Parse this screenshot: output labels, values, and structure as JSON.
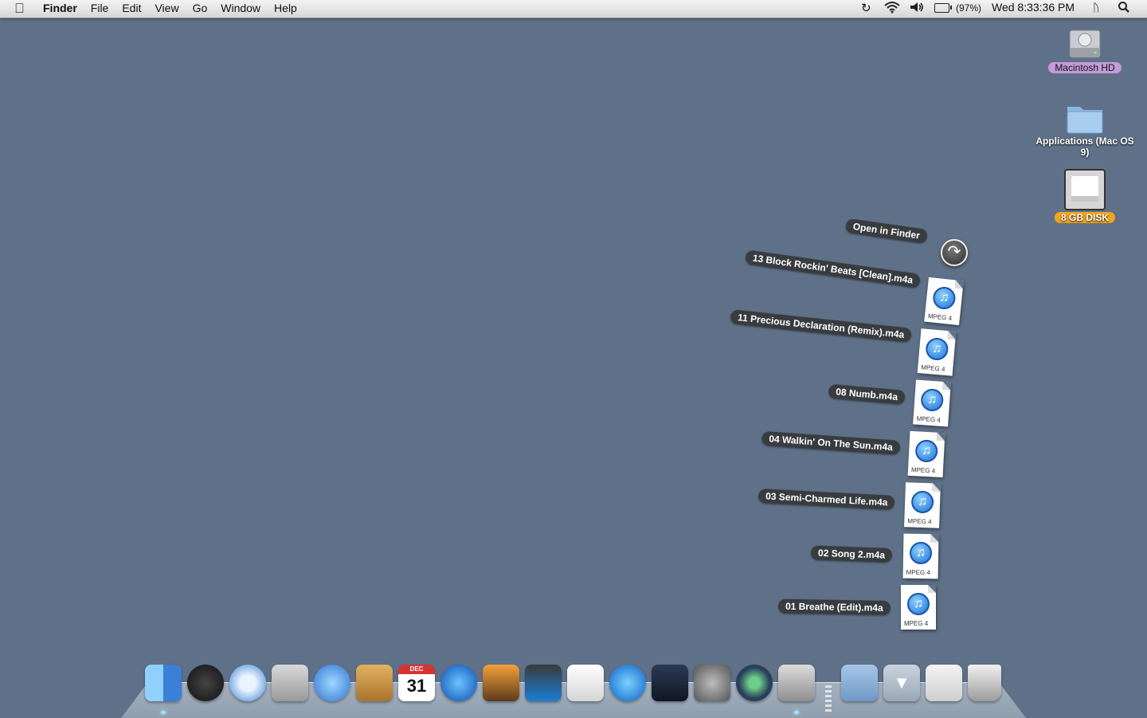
{
  "menubar": {
    "app_name": "Finder",
    "menus": [
      "File",
      "Edit",
      "View",
      "Go",
      "Window",
      "Help"
    ],
    "battery_percent": "(97%)",
    "clock": "Wed 8:33:36 PM",
    "status_icons": [
      "time-machine-icon",
      "wifi-icon",
      "volume-icon",
      "battery-icon",
      "bluetooth-icon",
      "spotlight-icon"
    ]
  },
  "desktop": {
    "icons": [
      {
        "label": "Macintosh HD",
        "icon": "hard-drive-icon",
        "label_color": "#c49ad8"
      },
      {
        "label": "Applications (Mac OS 9)",
        "icon": "folder-icon"
      },
      {
        "label": "8 GB DISK",
        "icon": "usb-disk-icon",
        "label_color": "#f3a51c"
      }
    ]
  },
  "stack": {
    "open_in_finder": "Open in Finder",
    "file_type": "MPEG 4",
    "files": [
      "13 Block Rockin' Beats [Clean].m4a",
      "11 Precious Declaration (Remix).m4a",
      "08 Numb.m4a",
      "04 Walkin' On The Sun.m4a",
      "03 Semi-Charmed Life.m4a",
      "02 Song 2.m4a",
      "01 Breathe (Edit).m4a"
    ]
  },
  "dock": {
    "apps": [
      "finder-icon",
      "dashboard-icon",
      "safari-icon",
      "calculator-icon",
      "ichat-icon",
      "address-book-icon",
      "ical-icon",
      "itunes-icon",
      "iphoto-icon",
      "imovie-icon",
      "textedit-icon",
      "quicktime-icon",
      "spaces-icon",
      "system-preferences-icon",
      "time-machine-icon",
      "utilities-icon"
    ],
    "ical_month": "DEC",
    "ical_day": "31",
    "stacks": [
      "applications-stack-icon",
      "downloads-stack-icon",
      "documents-stack-icon",
      "trash-icon"
    ],
    "colors": {
      "menubar": "#e6e6e6",
      "desktop": "#5f7188",
      "accent_blue": "#1b6fd6"
    }
  }
}
